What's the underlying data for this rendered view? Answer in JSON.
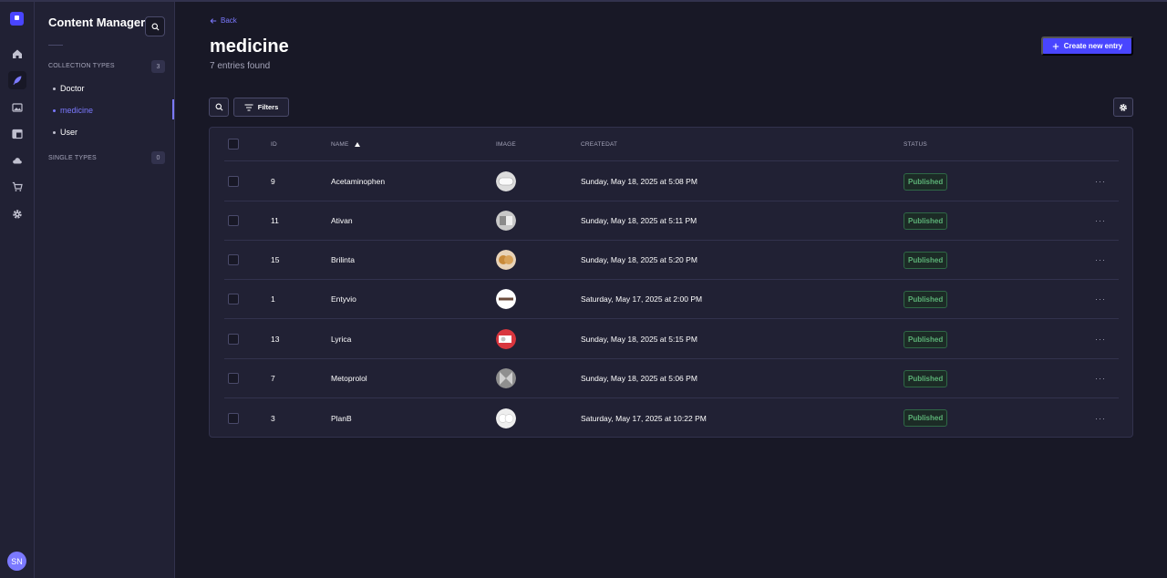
{
  "rail": {
    "avatar_initials": "SN"
  },
  "sidebar": {
    "title": "Content Manager",
    "collection_types_label": "COLLECTION TYPES",
    "collection_types_count": "3",
    "collection_items": [
      "Doctor",
      "medicine",
      "User"
    ],
    "single_types_label": "SINGLE TYPES",
    "single_types_count": "0"
  },
  "header": {
    "back_label": "Back",
    "title": "medicine",
    "subtitle": "7 entries found",
    "create_label": "Create new entry"
  },
  "toolbar": {
    "filters_label": "Filters"
  },
  "table": {
    "columns": {
      "id": "ID",
      "name": "NAME",
      "image": "IMAGE",
      "createdat": "CREATEDAT",
      "status": "STATUS"
    },
    "rows": [
      {
        "id": "9",
        "name": "Acetaminophen",
        "created": "Sunday, May 18, 2025 at 5:08 PM",
        "status": "Published"
      },
      {
        "id": "11",
        "name": "Ativan",
        "created": "Sunday, May 18, 2025 at 5:11 PM",
        "status": "Published"
      },
      {
        "id": "15",
        "name": "Brilinta",
        "created": "Sunday, May 18, 2025 at 5:20 PM",
        "status": "Published"
      },
      {
        "id": "1",
        "name": "Entyvio",
        "created": "Saturday, May 17, 2025 at 2:00 PM",
        "status": "Published"
      },
      {
        "id": "13",
        "name": "Lyrica",
        "created": "Sunday, May 18, 2025 at 5:15 PM",
        "status": "Published"
      },
      {
        "id": "7",
        "name": "Metoprolol",
        "created": "Sunday, May 18, 2025 at 5:06 PM",
        "status": "Published"
      },
      {
        "id": "3",
        "name": "PlanB",
        "created": "Saturday, May 17, 2025 at 10:22 PM",
        "status": "Published"
      }
    ],
    "more_label": "···"
  },
  "colors": {
    "accent": "#4945ff",
    "accent_light": "#7b79ff",
    "published_text": "#5cb176",
    "background": "#181826",
    "panel": "#212134"
  },
  "icons": [
    "logo-icon",
    "home-icon",
    "feather-icon",
    "image-icon",
    "layout-icon",
    "cloud-icon",
    "cart-icon",
    "gear-icon",
    "search-icon",
    "arrow-left-icon",
    "plus-icon",
    "filter-icon",
    "sort-up-icon"
  ]
}
